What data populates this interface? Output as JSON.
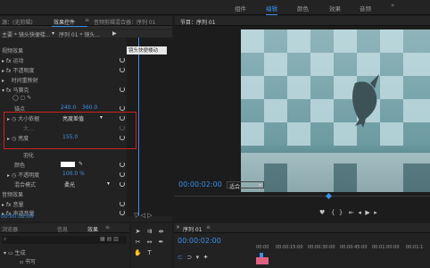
{
  "menubar": {
    "items": [
      "组件",
      "编辑",
      "颜色",
      "效果",
      "音频"
    ],
    "active_index": 1
  },
  "effect_controls": {
    "tabs": [
      "源：(无剪辑)",
      "效果控件",
      "音频剪辑混合器：序列 01"
    ],
    "active_tab": 1,
    "breadcrumb_source": "主要 * 镜头快便楼...",
    "breadcrumb_seq": "序列 01 * 镜头...",
    "clip_label": "镜头快便楼动",
    "section_video": "视频效果",
    "motion": "运动",
    "opacity": "不透明度",
    "time_remap": "时间重映射",
    "mosaic": "马赛克",
    "anchor_label": "锚点",
    "anchor_x": "240.0",
    "anchor_y": "360.0",
    "size_label": "大小依据",
    "size_value": "亮度差值",
    "size2_label": "大...",
    "brightness_label": "亮度",
    "brightness_value": "155.0",
    "feather_label": "羽化",
    "color_label": "颜色",
    "opacity2_label": "不透明度",
    "opacity2_value": "100.0 %",
    "blend_label": "混合模式",
    "blend_value": "柔光",
    "section_audio": "音频效果",
    "volume": "音量",
    "channel_volume": "声道音量",
    "timecode": "00:00:02:00"
  },
  "program_monitor": {
    "title": "节目：序列 01",
    "timecode": "00:00:02:00",
    "fit_value": "适合"
  },
  "project": {
    "tabs": [
      "浏览器",
      "信息",
      "效果"
    ],
    "active_tab": 2,
    "search_placeholder": "",
    "tree_item": "生成",
    "tree_subitem": "书写"
  },
  "timeline": {
    "title": "序列 01",
    "timecode": "00:00:02:00",
    "ruler": [
      "00:00",
      "00:00:15:00",
      "00:00:30:00",
      "00:00:45:00",
      "00:01:00:00",
      "00:01:1"
    ]
  },
  "colors": {
    "accent": "#3b8ee8",
    "selection_box": "#d02020",
    "panel_bg": "#222222"
  }
}
